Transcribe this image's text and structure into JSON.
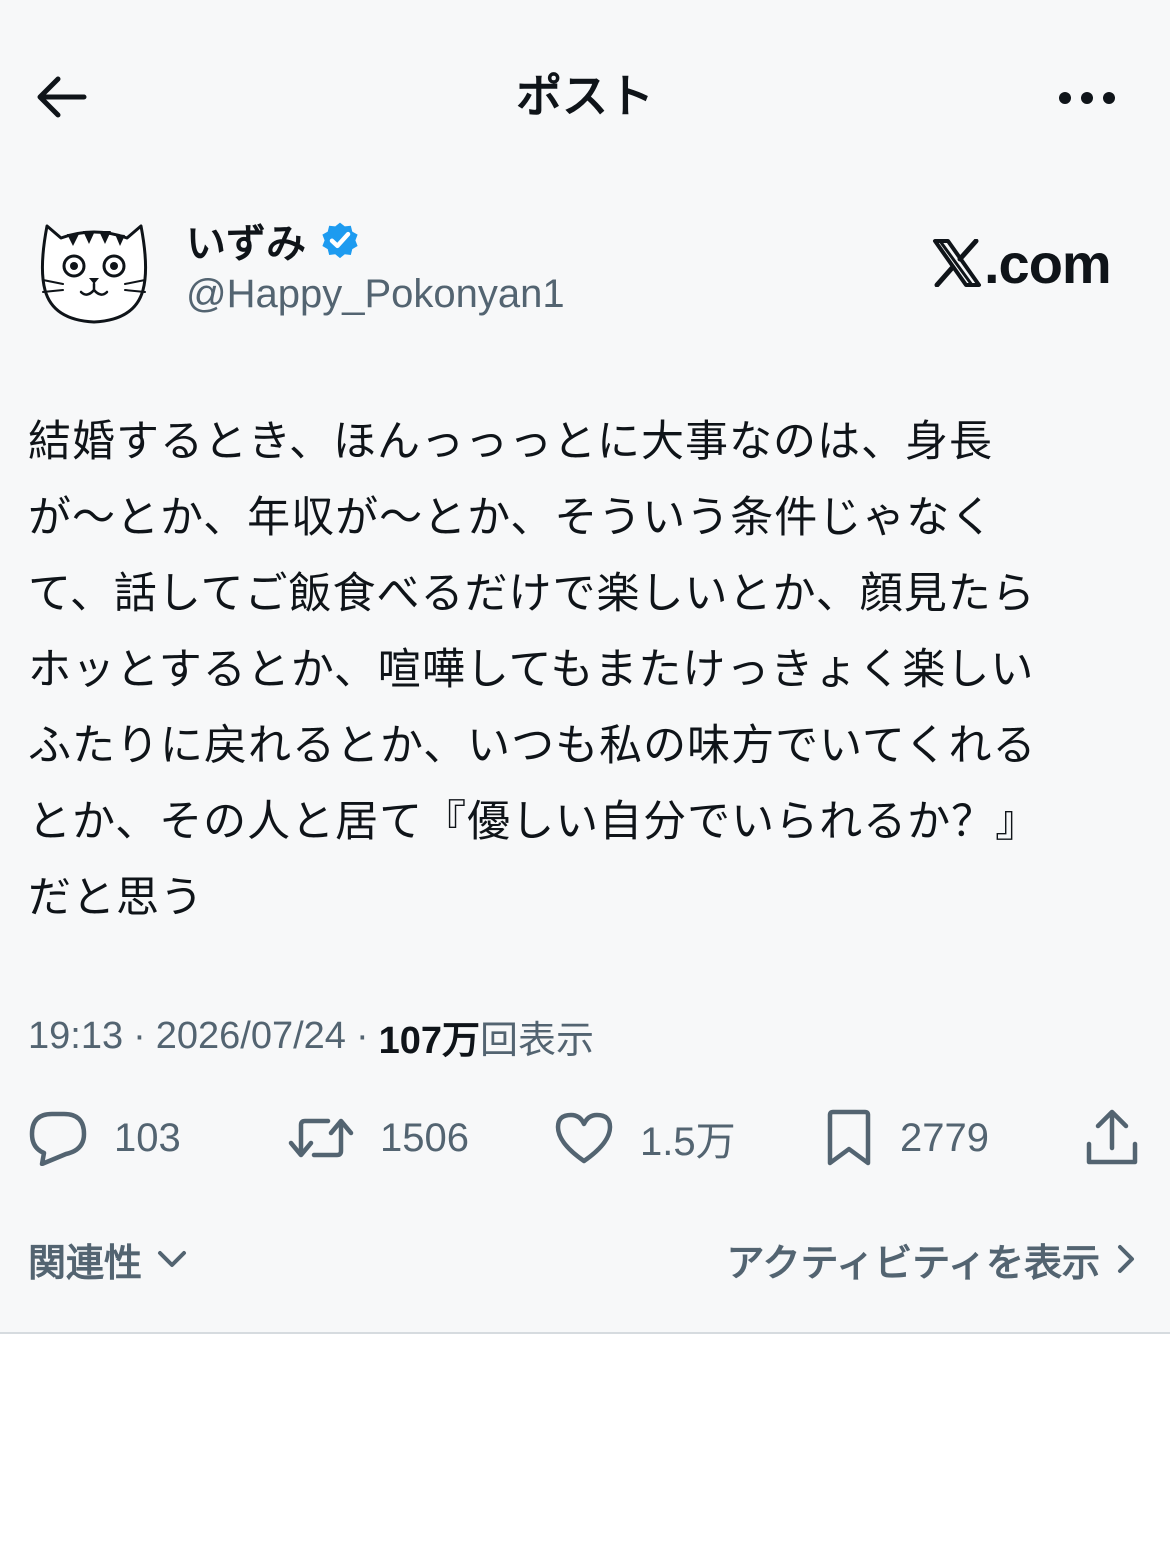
{
  "header": {
    "title": "ポスト",
    "back_icon": "arrow-left-icon",
    "more_icon": "more-horizontal-icon"
  },
  "author": {
    "name": "いずみ",
    "handle": "@Happy_Pokonyan1",
    "verified": true,
    "verified_color": "#1d9bf0",
    "avatar_icon": "cat-face-avatar"
  },
  "watermark": {
    "text": ".com",
    "logo_icon": "x-logo-icon"
  },
  "tweet": {
    "text": "結婚するとき、ほんっっっとに大事なのは、身長\nが〜とか、年収が〜とか、そういう条件じゃなく\nて、話してご飯食べるだけで楽しいとか、顔見たら\nホッとするとか、喧嘩してもまたけっきょく楽しい\nふたりに戻れるとか、いつも私の味方でいてくれる\nとか、その人と居て『優しい自分でいられるか？』\nだと思う"
  },
  "meta": {
    "time": "19:13",
    "separator": "·",
    "date": "2026/07/24",
    "views_number": "107万",
    "views_label": "回表示"
  },
  "actions": {
    "reply": {
      "icon": "reply-icon",
      "count": "103"
    },
    "retweet": {
      "icon": "retweet-icon",
      "count": "1506"
    },
    "like": {
      "icon": "heart-icon",
      "count": "1.5万"
    },
    "bookmark": {
      "icon": "bookmark-icon",
      "count": "2779"
    },
    "share": {
      "icon": "share-icon"
    }
  },
  "footer": {
    "relevance_label": "関連性",
    "activity_label": "アクティビティを表示"
  },
  "colors": {
    "background": "#f7f8f9",
    "text_primary": "#0f1419",
    "text_secondary": "#536471",
    "accent": "#1d9bf0"
  }
}
